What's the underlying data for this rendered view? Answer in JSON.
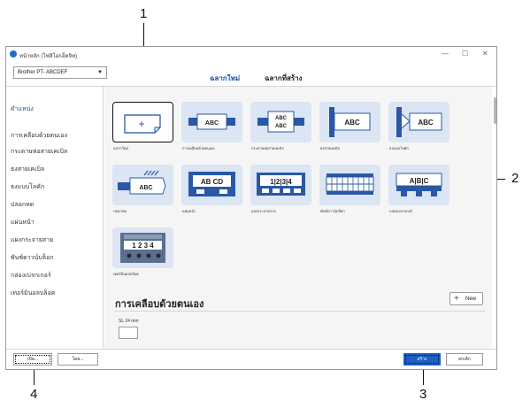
{
  "window": {
    "title": "หน้าหลัก (โฟลิโอ/เอ็ดจิท)"
  },
  "printer_select": {
    "value": "Brother PT- ABCDEF"
  },
  "tabs": [
    {
      "label": "ฉลากใหม่",
      "active": true
    },
    {
      "label": "ฉลากที่สร้าง",
      "active": false
    }
  ],
  "sidebar": {
    "items": [
      {
        "label": "ตำแหน่ง",
        "active": true
      },
      {
        "label": "การเคลือบด้วยตนเอง",
        "active": false
      },
      {
        "label": "กระดาษห่อสายเคเบิล",
        "active": false
      },
      {
        "label": "ธงสายเคเบิล",
        "active": false
      },
      {
        "label": "ธงแบบโลคัก",
        "active": false
      },
      {
        "label": "ปลอกหด",
        "active": false
      },
      {
        "label": "แผ่นหน้า",
        "active": false
      },
      {
        "label": "แผงกระจายสาย",
        "active": false
      },
      {
        "label": "พันช์ดาวน์บล็อก",
        "active": false
      },
      {
        "label": "กล่องเบรกเกอร์",
        "active": false
      },
      {
        "label": "เทอร์มินอลบล็อค",
        "active": false
      }
    ]
  },
  "templates": [
    {
      "label": "ฉลากใหม่",
      "icon": "new-label-icon",
      "glyph": "+"
    },
    {
      "label": "การเคลือบด้วยตนเอง",
      "icon": "self-laminating-cable-icon",
      "glyph": "ABC"
    },
    {
      "label": "กระดาษห่อสายเคเบิล",
      "icon": "cable-wrap-icon",
      "glyph": "ABC"
    },
    {
      "label": "ธงสายเคเบิล",
      "icon": "cable-flag-icon",
      "glyph": "ABC"
    },
    {
      "label": "ธงแบบโลคัก",
      "icon": "flag-icon",
      "glyph": "ABC"
    },
    {
      "label": "ปลอกหด",
      "icon": "heat-shrink-tube-icon",
      "glyph": "ABC"
    },
    {
      "label": "แผ่นหน้า",
      "icon": "faceplate-icon",
      "glyph": "AB CD"
    },
    {
      "label": "แผงกระจายสาย",
      "icon": "patch-panel-icon",
      "glyph": "1|2|3|4"
    },
    {
      "label": "พันช์ดาวน์บล็อก",
      "icon": "punch-down-block-icon",
      "glyph": ""
    },
    {
      "label": "กล่องเบรกเกอร์",
      "icon": "breaker-box-icon",
      "glyph": "A|B|C"
    },
    {
      "label": "เทอร์มินอลบล็อค",
      "icon": "terminal-block-icon",
      "glyph": "1 2 3 4"
    }
  ],
  "section": {
    "title": "การเคลือบด้วยตนเอง",
    "new_label": "New",
    "sl_label": "SL 24 mm"
  },
  "footer": {
    "open_label": "เปิด...",
    "other_label": "โดย...",
    "create_label": "สร้าง",
    "cancel_label": "ยกเลิก"
  },
  "callouts": {
    "c1": "1",
    "c2": "2",
    "c3": "3",
    "c4": "4"
  },
  "colors": {
    "accent": "#1a4fa8",
    "primary_button": "#1f5fbf",
    "tile_bg": "#dbe5f3"
  }
}
